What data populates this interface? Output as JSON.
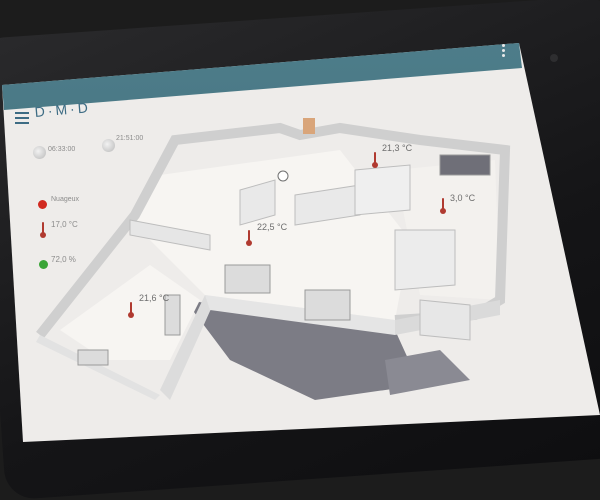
{
  "app": {
    "logo": "≡D·M·D",
    "logo_text": "D·M·D"
  },
  "header": {
    "time_left": "06:33:00",
    "time_right": "21:51:00"
  },
  "weather": {
    "condition": "Nuageux",
    "condition_color": "#d12a20",
    "outdoor_temp": "17,0 °C",
    "humidity": "72,0 %",
    "humidity_color": "#3aa537"
  },
  "rooms": [
    {
      "temp": "21,3 °C"
    },
    {
      "temp": "3,0 °C"
    },
    {
      "temp": "22,5 °C"
    },
    {
      "temp": "21,6 °C"
    }
  ],
  "colors": {
    "appbar": "#4a7a88",
    "accent": "#3d6c84",
    "thermometer": "#b03a30"
  }
}
